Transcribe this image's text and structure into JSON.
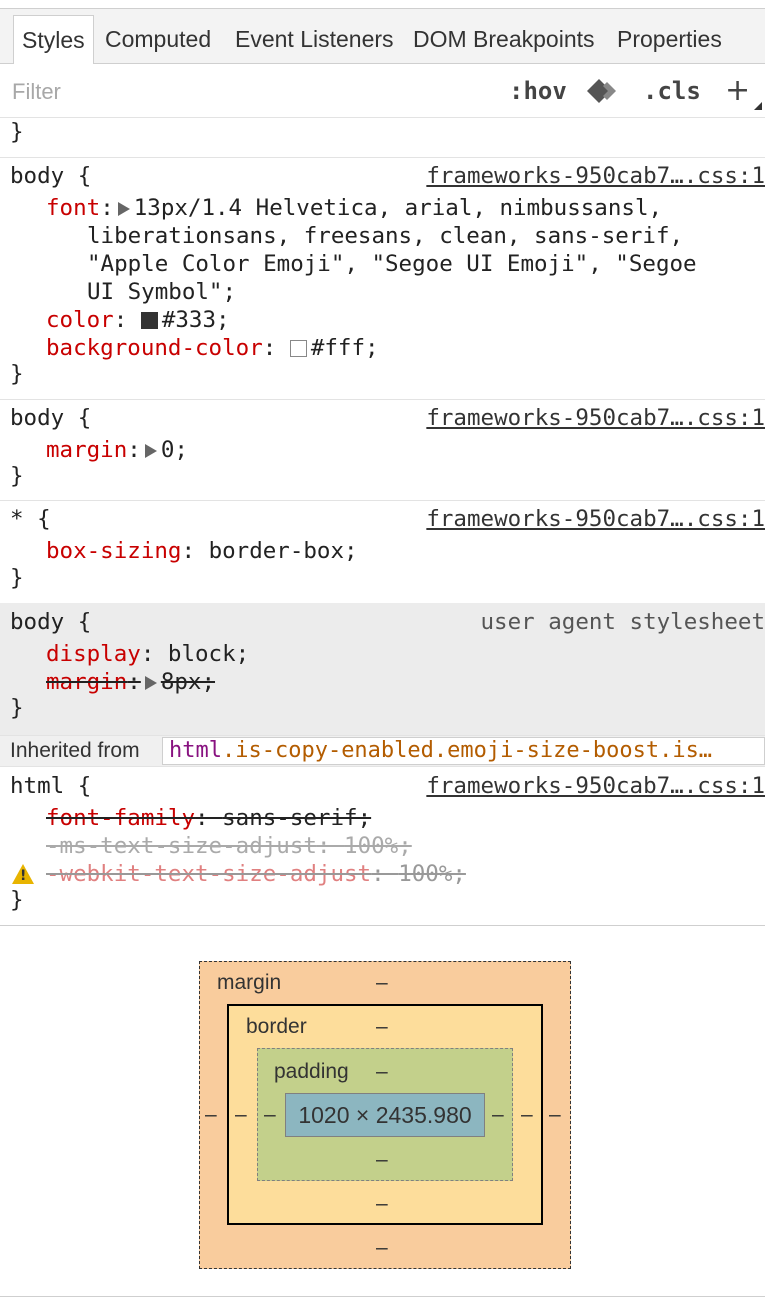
{
  "tabs": [
    {
      "label": "Styles",
      "active": true
    },
    {
      "label": "Computed"
    },
    {
      "label": "Event Listeners"
    },
    {
      "label": "DOM Breakpoints"
    },
    {
      "label": "Properties"
    }
  ],
  "toolbar": {
    "filter_placeholder": "Filter",
    "hov": ":hov",
    "cls": ".cls",
    "add": "+"
  },
  "rules": {
    "prev_close": "}",
    "r1": {
      "selector": "body {",
      "source": "frameworks-950cab7….css:1",
      "font_prop": "font",
      "font_val_1": "13px/1.4 Helvetica, arial, nimbussansl,",
      "font_val_2": "liberationsans, freesans, clean, sans-serif,",
      "font_val_3": "\"Apple Color Emoji\", \"Segoe UI Emoji\", \"Segoe",
      "font_val_4": "UI Symbol\";",
      "color_prop": "color",
      "color_val": "#333;",
      "bg_prop": "background-color",
      "bg_val": "#fff;",
      "close": "}"
    },
    "r2": {
      "selector": "body {",
      "source": "frameworks-950cab7….css:1",
      "margin_prop": "margin",
      "margin_val": "0;",
      "close": "}"
    },
    "r3": {
      "selector": "* {",
      "source": "frameworks-950cab7….css:1",
      "prop": "box-sizing",
      "val": "border-box;",
      "close": "}"
    },
    "r4": {
      "selector": "body {",
      "source": "user agent stylesheet",
      "display_prop": "display",
      "display_val": "block;",
      "margin_prop": "margin",
      "margin_val": "8px;",
      "close": "}"
    },
    "inherited": {
      "label": "Inherited from",
      "tag": "html",
      "classes": ".is-copy-enabled.emoji-size-boost.is…"
    },
    "r5": {
      "selector": "html {",
      "source": "frameworks-950cab7….css:1",
      "ff_prop": "font-family",
      "ff_val": "sans-serif;",
      "ms_prop": "-ms-text-size-adjust",
      "ms_val": "100%;",
      "wk_prop": "-webkit-text-size-adjust",
      "wk_val": "100%;",
      "close": "}"
    }
  },
  "box_model": {
    "margin_label": "margin",
    "border_label": "border",
    "padding_label": "padding",
    "content": "1020 × 2435.980",
    "dash": "–"
  },
  "colors": {
    "color_swatch": "#333333",
    "bg_swatch": "#ffffff",
    "margin": "#f9cc9d",
    "border": "#fddd9b",
    "padding": "#c3d08b",
    "content": "#8cb6c0"
  }
}
